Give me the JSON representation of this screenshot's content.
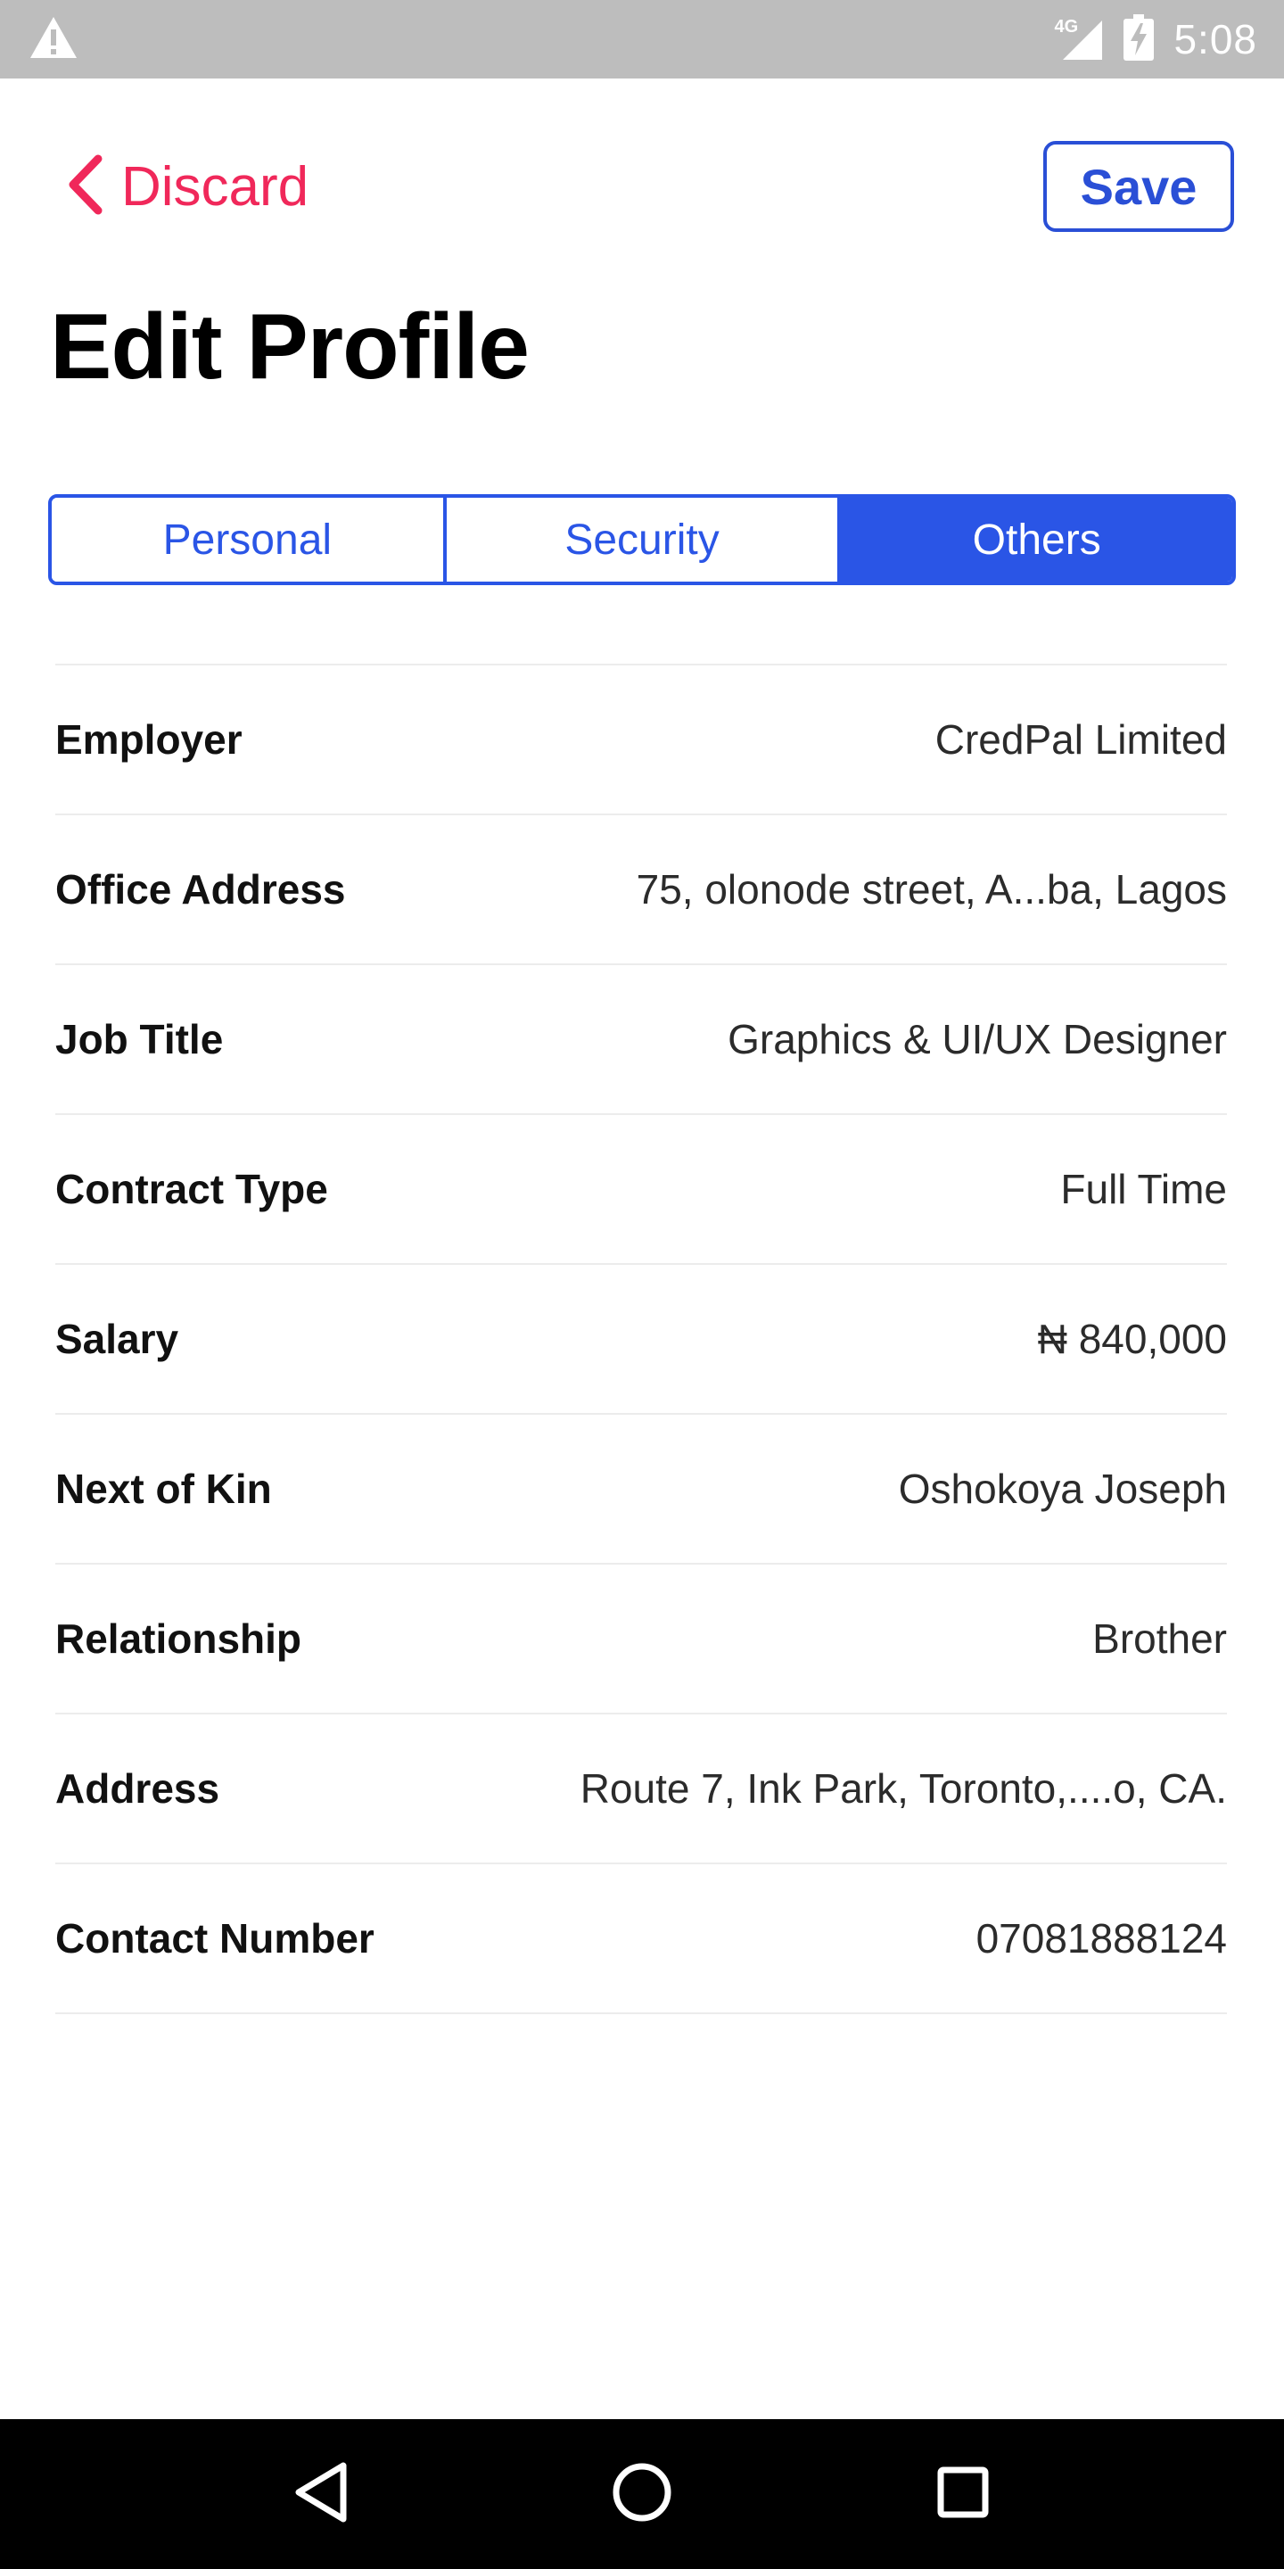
{
  "status_bar": {
    "time": "5:08",
    "network": "4G",
    "icons": [
      "warning-icon",
      "signal-icon",
      "battery-charging-icon"
    ]
  },
  "header": {
    "back_label": "Discard",
    "save_label": "Save",
    "title": "Edit Profile"
  },
  "tabs": [
    {
      "label": "Personal",
      "active": false
    },
    {
      "label": "Security",
      "active": false
    },
    {
      "label": "Others",
      "active": true
    }
  ],
  "fields": [
    {
      "label": "Employer",
      "value": "CredPal Limited"
    },
    {
      "label": "Office Address",
      "value": "75, olonode street, A...ba, Lagos"
    },
    {
      "label": "Job Title",
      "value": "Graphics & UI/UX Designer"
    },
    {
      "label": "Contract Type",
      "value": "Full Time"
    },
    {
      "label": "Salary",
      "value": "₦ 840,000"
    },
    {
      "label": "Next of Kin",
      "value": "Oshokoya Joseph"
    },
    {
      "label": "Relationship",
      "value": "Brother"
    },
    {
      "label": "Address",
      "value": "Route 7, Ink Park, Toronto,....o, CA."
    },
    {
      "label": "Contact Number",
      "value": "07081888124"
    }
  ],
  "nav_bar": {
    "icons": [
      "back-triangle-icon",
      "home-circle-icon",
      "recents-square-icon"
    ]
  },
  "colors": {
    "accent": "#2a55e6",
    "save_border": "#2a4fd6",
    "discard": "#f0285a",
    "status_bar": "#bdbdbd",
    "nav_bar": "#000000",
    "divider": "#ececec"
  }
}
